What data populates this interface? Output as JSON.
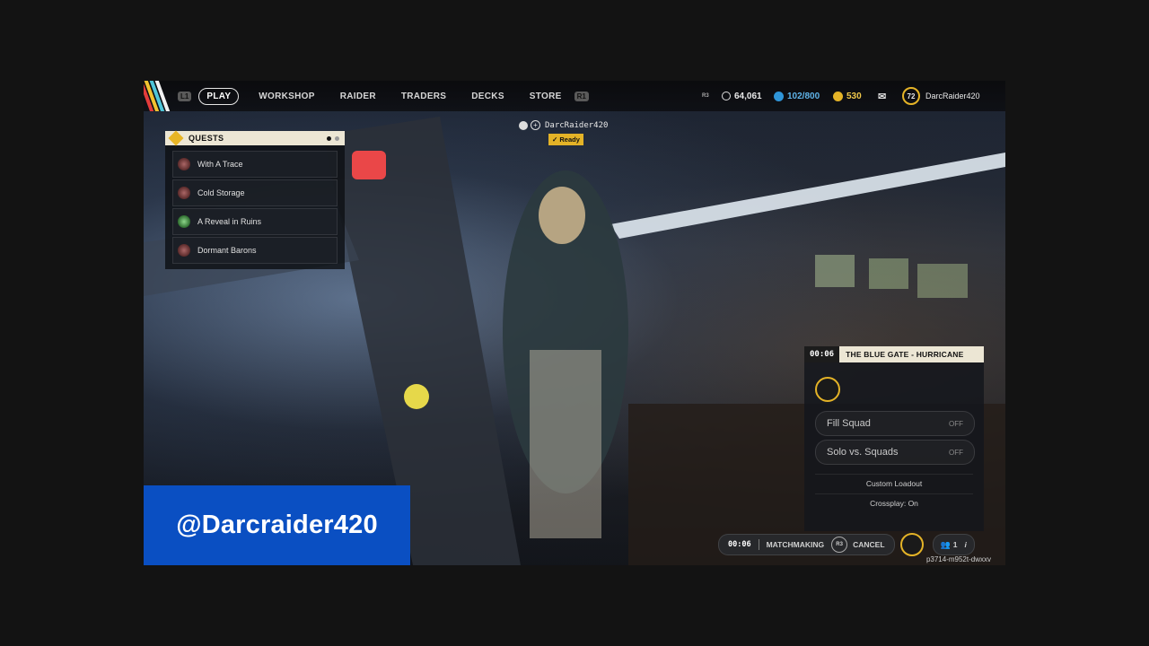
{
  "colors": {
    "accent_yellow": "#e7b526",
    "panel_cream": "#ece6d4",
    "watermark_blue": "#0a4fc2",
    "creds_blue": "#2f95d8",
    "ready_yellow": "#e4b327"
  },
  "nav": {
    "left_hint": "L1",
    "items": [
      "PLAY",
      "WORKSHOP",
      "RAIDER",
      "TRADERS",
      "DECKS",
      "STORE"
    ],
    "right_hint": "R1"
  },
  "resources": {
    "r3_hint": "R3",
    "coins": "64,061",
    "creds": "102/800",
    "tokens": "530",
    "level": "72",
    "username": "DarcRaider420"
  },
  "quests": {
    "title": "QUESTS",
    "items": [
      {
        "label": "With A Trace",
        "icon": "raider-face-icon"
      },
      {
        "label": "Cold Storage",
        "icon": "raider-face-icon"
      },
      {
        "label": "A Reveal in Ruins",
        "icon": "map-marker-icon"
      },
      {
        "label": "Dormant Barons",
        "icon": "raider-face-icon"
      }
    ]
  },
  "player": {
    "name": "DarcRaider420",
    "status": "Ready"
  },
  "matchmaking_panel": {
    "timer": "00:06",
    "map": "THE BLUE GATE - HURRICANE",
    "options": [
      {
        "label": "Fill Squad",
        "value": "OFF"
      },
      {
        "label": "Solo vs. Squads",
        "value": "OFF"
      }
    ],
    "custom_loadout": "Custom Loadout",
    "crossplay": "Crossplay: On"
  },
  "bottom_bar": {
    "timer": "00:06",
    "status": "MATCHMAKING",
    "cancel_hint": "R3",
    "cancel_label": "CANCEL",
    "squad_count": "1"
  },
  "session_code": "p3714-m952t-dwxxv",
  "watermark": "@Darcraider420"
}
